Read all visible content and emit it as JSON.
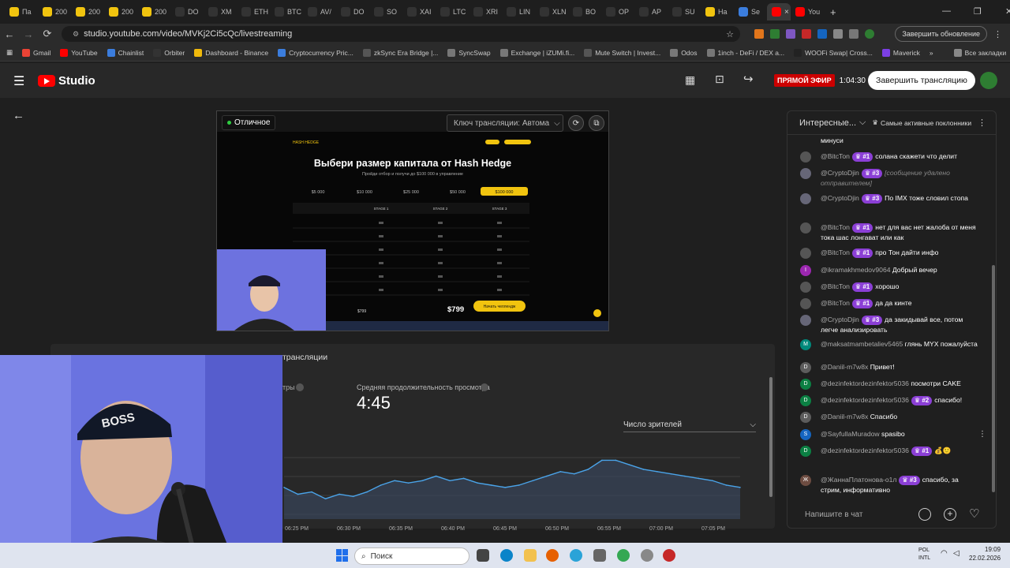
{
  "browser": {
    "tabs": [
      {
        "label": "Па",
        "color": "#f1c40f"
      },
      {
        "label": "200",
        "color": "#f1c40f"
      },
      {
        "label": "200",
        "color": "#f1c40f"
      },
      {
        "label": "200",
        "color": "#f1c40f"
      },
      {
        "label": "200",
        "color": "#f1c40f"
      },
      {
        "label": "DO",
        "color": "#333"
      },
      {
        "label": "XM",
        "color": "#333"
      },
      {
        "label": "ETH",
        "color": "#333"
      },
      {
        "label": "BTC",
        "color": "#333"
      },
      {
        "label": "AV/",
        "color": "#333"
      },
      {
        "label": "DO",
        "color": "#333"
      },
      {
        "label": "SO",
        "color": "#333"
      },
      {
        "label": "XAI",
        "color": "#333"
      },
      {
        "label": "LTC",
        "color": "#333"
      },
      {
        "label": "XRI",
        "color": "#333"
      },
      {
        "label": "LIN",
        "color": "#333"
      },
      {
        "label": "XLN",
        "color": "#333"
      },
      {
        "label": "BO",
        "color": "#333"
      },
      {
        "label": "OP",
        "color": "#333"
      },
      {
        "label": "AP",
        "color": "#333"
      },
      {
        "label": "SU",
        "color": "#333"
      },
      {
        "label": "Ha",
        "color": "#f1c40f"
      },
      {
        "label": "Se",
        "color": "#3b7ddd"
      }
    ],
    "active_tab_close": "×",
    "last_tab": "You",
    "new_tab": "+",
    "url": "studio.youtube.com/video/MVKj2Ci5cQc/livestreaming",
    "update_label": "Завершить обновление",
    "bookmarks": [
      {
        "label": "Gmail",
        "color": "#ea4335"
      },
      {
        "label": "YouTube",
        "color": "#ff0000"
      },
      {
        "label": "Chainlist",
        "color": "#3b7ddd"
      },
      {
        "label": "Orbiter",
        "color": "#333"
      },
      {
        "label": "Dashboard - Binance",
        "color": "#f0b90b"
      },
      {
        "label": "Cryptocurrency Pric...",
        "color": "#3b7ddd"
      },
      {
        "label": "zkSync Era Bridge |...",
        "color": "#555"
      },
      {
        "label": "SyncSwap",
        "color": "#777"
      },
      {
        "label": "Exchange | iZUMi.fi...",
        "color": "#777"
      },
      {
        "label": "Mute Switch | Invest...",
        "color": "#555"
      },
      {
        "label": "Odos",
        "color": "#777"
      },
      {
        "label": "1inch - DeFi / DEX a...",
        "color": "#777"
      },
      {
        "label": "WOOFi Swap| Cross...",
        "color": "#222"
      },
      {
        "label": "Maverick",
        "color": "#7b3fe4"
      }
    ],
    "all_bookmarks": "Все закладки"
  },
  "studio": {
    "logo_text": "Studio",
    "live_badge": "ПРЯМОЙ ЭФИР",
    "live_timer": "1:04:30",
    "end_button": "Завершить трансляцию"
  },
  "preview": {
    "quality": "Отличное",
    "stream_key_select": "Ключ трансляции: Автома",
    "site": {
      "logo": "HASH HEDGE",
      "heading": "Выбери размер капитала от Hash Hedge",
      "subheading": "Пройди отбор и получи до $100 000 в управление",
      "amounts": [
        "$5 000",
        "$10 000",
        "$25 000",
        "$50 000",
        "$100 000"
      ],
      "stages": [
        "STAGE 1",
        "STAGE 2",
        "STAGE 3"
      ],
      "price_left": "$799",
      "price_right": "$799",
      "cta": "Начать челлендж"
    }
  },
  "stats": {
    "tab_label": "трансляции",
    "metric_label_partial": "тры",
    "avg_view_label": "Средняя продолжительность просмотра",
    "avg_view_value": "4:45",
    "dropdown": "Число зрителей",
    "x_labels": [
      "06:25 PM",
      "06:30 PM",
      "06:35 PM",
      "06:40 PM",
      "06:45 PM",
      "06:50 PM",
      "06:55 PM",
      "07:00 PM",
      "07:05 PM"
    ]
  },
  "chart_data": {
    "type": "area",
    "series": [
      {
        "values": [
          14,
          11,
          12,
          9,
          11,
          10,
          12,
          15,
          17,
          16,
          17,
          19,
          17,
          18,
          16,
          15,
          14,
          15,
          17,
          19,
          21,
          20,
          22,
          26,
          26,
          24,
          22,
          21,
          20,
          19,
          18,
          17,
          15,
          14
        ]
      }
    ],
    "x": [
      "06:25 PM",
      "06:30 PM",
      "06:35 PM",
      "06:40 PM",
      "06:45 PM",
      "06:50 PM",
      "06:55 PM",
      "07:00 PM",
      "07:05 PM"
    ],
    "ylim": [
      0,
      30
    ],
    "grid": true,
    "title": ""
  },
  "chat": {
    "header": "Интересные...",
    "top_fans": "Самые активные поклонники",
    "messages": [
      {
        "initial": "",
        "color": "#555",
        "author": "",
        "badge": "",
        "text": "минуси"
      },
      {
        "initial": "",
        "color": "#555",
        "author": "@BitcTon",
        "badge": "#1",
        "text": "солана скажети что делит"
      },
      {
        "initial": "",
        "color": "#667",
        "author": "@CryptoDjin",
        "badge": "#3",
        "text": "[сообщение удалено отправителем]"
      },
      {
        "initial": "",
        "color": "#667",
        "author": "@CryptoDjin",
        "badge": "#3",
        "text": "По IMX тоже словил стопа"
      },
      {
        "initial": "",
        "color": "#555",
        "author": "@BitcTon",
        "badge": "#1",
        "text": "нет для вас нет жалоба от меня тока шас лонгават или как"
      },
      {
        "initial": "",
        "color": "#555",
        "author": "@BitcTon",
        "badge": "#1",
        "text": "про Тон дайти инфо"
      },
      {
        "initial": "I",
        "color": "#9c27b0",
        "author": "@ikramakhmedov9064",
        "badge": "",
        "text": "Добрый вечер"
      },
      {
        "initial": "",
        "color": "#555",
        "author": "@BitcTon",
        "badge": "#1",
        "text": "хорошо"
      },
      {
        "initial": "",
        "color": "#555",
        "author": "@BitcTon",
        "badge": "#1",
        "text": "да да кинте"
      },
      {
        "initial": "",
        "color": "#667",
        "author": "@CryptoDjin",
        "badge": "#3",
        "text": "да закидывай все, потом легче анализировать"
      },
      {
        "initial": "M",
        "color": "#00897b",
        "author": "@maksatmambetaliev5465",
        "badge": "",
        "text": "глянь MYX пожалуйста"
      },
      {
        "initial": "D",
        "color": "#5c5c5c",
        "author": "@Daniil-m7w8x",
        "badge": "",
        "text": "Привет!"
      },
      {
        "initial": "D",
        "color": "#0b8043",
        "author": "@dezinfektordezinfektor5036",
        "badge": "",
        "text": "посмотри CAKE"
      },
      {
        "initial": "D",
        "color": "#0b8043",
        "author": "@dezinfektordezinfektor5036",
        "badge": "#2",
        "text": "спасибо!"
      },
      {
        "initial": "D",
        "color": "#5c5c5c",
        "author": "@Daniil-m7w8x",
        "badge": "",
        "text": "Спасибо"
      },
      {
        "initial": "S",
        "color": "#1565c0",
        "author": "@SayfullaMuradow",
        "badge": "",
        "text": "spasibo"
      },
      {
        "initial": "D",
        "color": "#0b8043",
        "author": "@dezinfektordezinfektor5036",
        "badge": "#1",
        "text": "💰🙂"
      },
      {
        "initial": "Ж",
        "color": "#6d4c41",
        "author": "@ЖаннаПлатонова-о1л",
        "badge": "#3",
        "text": "спасибо, за стрим, информативно"
      }
    ],
    "input_placeholder": "Напишите в чат"
  },
  "taskbar": {
    "search": "Поиск",
    "lang1": "POL",
    "lang2": "INTL",
    "time": "19:09",
    "date": "22.02.2026"
  }
}
